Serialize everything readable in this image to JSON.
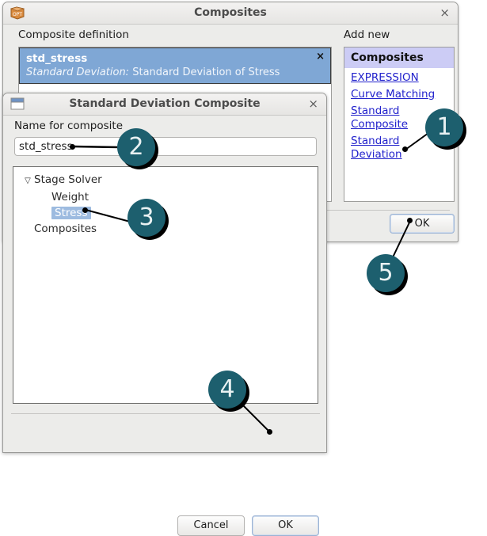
{
  "outer_dialog": {
    "title": "Composites",
    "icon": "opt-icon",
    "close_label": "×",
    "composite_definition_label": "Composite definition",
    "add_new_label": "Add new",
    "composite_item": {
      "name": "std_stress",
      "type_prefix": "Standard Deviation:",
      "description": "Standard Deviation of Stress",
      "remove_label": "×"
    },
    "add_new_panel": {
      "header": "Composites",
      "links": [
        "EXPRESSION",
        "Curve Matching",
        "Standard Composite",
        "Standard Deviation"
      ]
    },
    "ok_label": "OK"
  },
  "inner_dialog": {
    "title": "Standard Deviation Composite",
    "icon": "window-icon",
    "close_label": "×",
    "name_label": "Name for composite",
    "name_value": "std_stress",
    "name_placeholder": "",
    "tree": [
      {
        "label": "Stage Solver",
        "depth": 0,
        "expanded": true,
        "selected": false
      },
      {
        "label": "Weight",
        "depth": 1,
        "expanded": false,
        "selected": false
      },
      {
        "label": "Stress",
        "depth": 1,
        "expanded": false,
        "selected": true
      },
      {
        "label": "Composites",
        "depth": 0,
        "expanded": false,
        "selected": false
      }
    ],
    "cancel_label": "Cancel",
    "ok_label": "OK"
  },
  "callouts": [
    {
      "number": "1",
      "target": "Standard Deviation link"
    },
    {
      "number": "2",
      "target": "name for composite field"
    },
    {
      "number": "3",
      "target": "Stress tree item"
    },
    {
      "number": "4",
      "target": "inner OK button"
    },
    {
      "number": "5",
      "target": "outer OK button"
    }
  ],
  "colors": {
    "callout_fill": "#1d5f6e",
    "callout_text": "#e9f1f2",
    "selection_blue": "#7fa7d5",
    "tree_selection": "#9dbbe0",
    "link_blue": "#2222cc",
    "header_lavender": "#ccccf5",
    "dialog_bg": "#ececea"
  }
}
